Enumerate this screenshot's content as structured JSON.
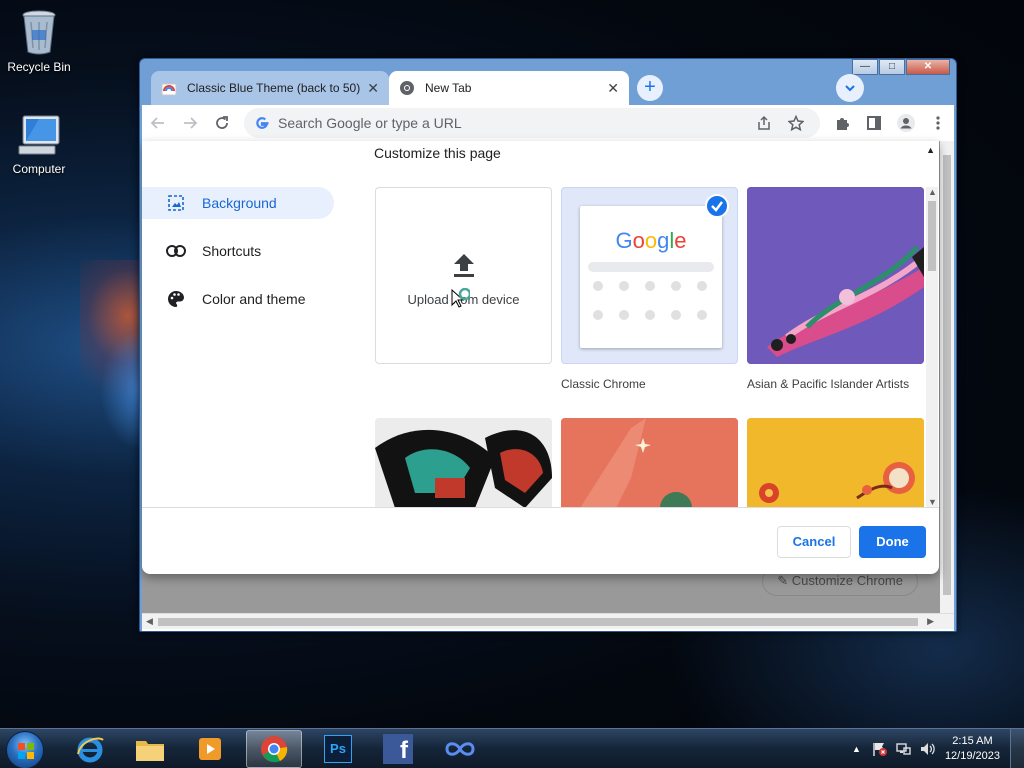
{
  "desktop": {
    "icons": [
      {
        "label": "Recycle Bin",
        "icon": "recycle-bin-icon"
      },
      {
        "label": "Computer",
        "icon": "computer-icon"
      }
    ]
  },
  "browser": {
    "tabs": [
      {
        "label": "Classic Blue Theme (back to 50)",
        "active": false,
        "close": "✕"
      },
      {
        "label": "New Tab",
        "active": true,
        "close": "✕"
      }
    ],
    "new_tab": "+",
    "tab_search": "⌄",
    "window_controls": {
      "minimize": "—",
      "maximize": "□",
      "close": "✕"
    },
    "omnibox": {
      "placeholder": "Search Google or type a URL",
      "value": ""
    },
    "page": {
      "customize_chrome": "✎  Customize Chrome"
    }
  },
  "dialog": {
    "title": "Customize this page",
    "nav": [
      {
        "label": "Background",
        "icon": "image-icon",
        "selected": true
      },
      {
        "label": "Shortcuts",
        "icon": "link-icon",
        "selected": false
      },
      {
        "label": "Color and theme",
        "icon": "palette-icon",
        "selected": false
      }
    ],
    "tiles": {
      "upload": "Upload from device",
      "classic": "Classic Chrome",
      "classic_logo": "Google",
      "artists": "Asian & Pacific Islander Artists"
    },
    "buttons": {
      "cancel": "Cancel",
      "done": "Done"
    },
    "colors": {
      "accent": "#1a73e8",
      "selected_bg": "#e8f0fe"
    }
  },
  "taskbar": {
    "apps": [
      "internet-explorer-icon",
      "file-explorer-icon",
      "media-player-icon",
      "chrome-icon",
      "photoshop-icon",
      "facebook-icon",
      "infinity-icon"
    ],
    "photoshop_label": "Ps",
    "facebook_label": "f",
    "tray": {
      "expand": "▲"
    },
    "clock": {
      "time": "2:15 AM",
      "date": "12/19/2023"
    }
  }
}
